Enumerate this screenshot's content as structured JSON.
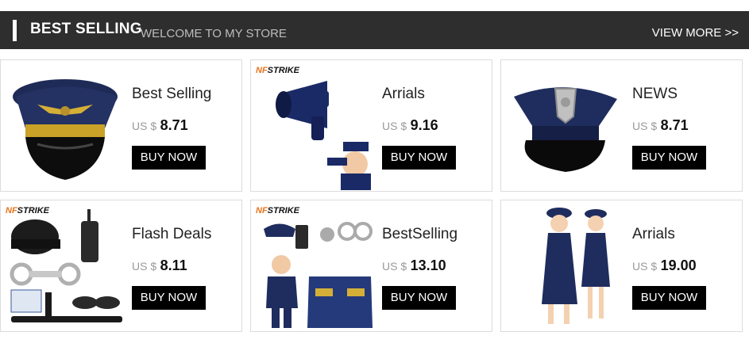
{
  "header": {
    "title": "BEST SELLING",
    "subtitle": "WELCOME TO MY STORE",
    "view_more": "VIEW MORE >>"
  },
  "products": [
    {
      "name": "Best Selling",
      "currency": "US $",
      "price": "8.71",
      "button": "BUY NOW",
      "image_icon": "pilot-cap-icon",
      "brand": ""
    },
    {
      "name": "Arrials",
      "currency": "US $",
      "price": "9.16",
      "button": "BUY NOW",
      "image_icon": "police-megaphone-icon",
      "brand_a": "NF",
      "brand_b": "STRIKE"
    },
    {
      "name": "NEWS",
      "currency": "US $",
      "price": "8.71",
      "button": "BUY NOW",
      "image_icon": "police-cap-icon",
      "brand": ""
    },
    {
      "name": "Flash Deals",
      "currency": "US $",
      "price": "8.11",
      "button": "BUY NOW",
      "image_icon": "police-gear-set-icon",
      "brand_a": "NF",
      "brand_b": "STRIKE"
    },
    {
      "name": "BestSelling",
      "currency": "US $",
      "price": "13.10",
      "button": "BUY NOW",
      "image_icon": "police-costume-icon",
      "brand_a": "NF",
      "brand_b": "STRIKE"
    },
    {
      "name": "Arrials",
      "currency": "US $",
      "price": "19.00",
      "button": "BUY NOW",
      "image_icon": "police-girls-costume-icon",
      "brand": ""
    }
  ],
  "colors": {
    "header_bg": "#2e2e2e",
    "button_bg": "#000000",
    "cap_navy": "#1f2b57"
  }
}
